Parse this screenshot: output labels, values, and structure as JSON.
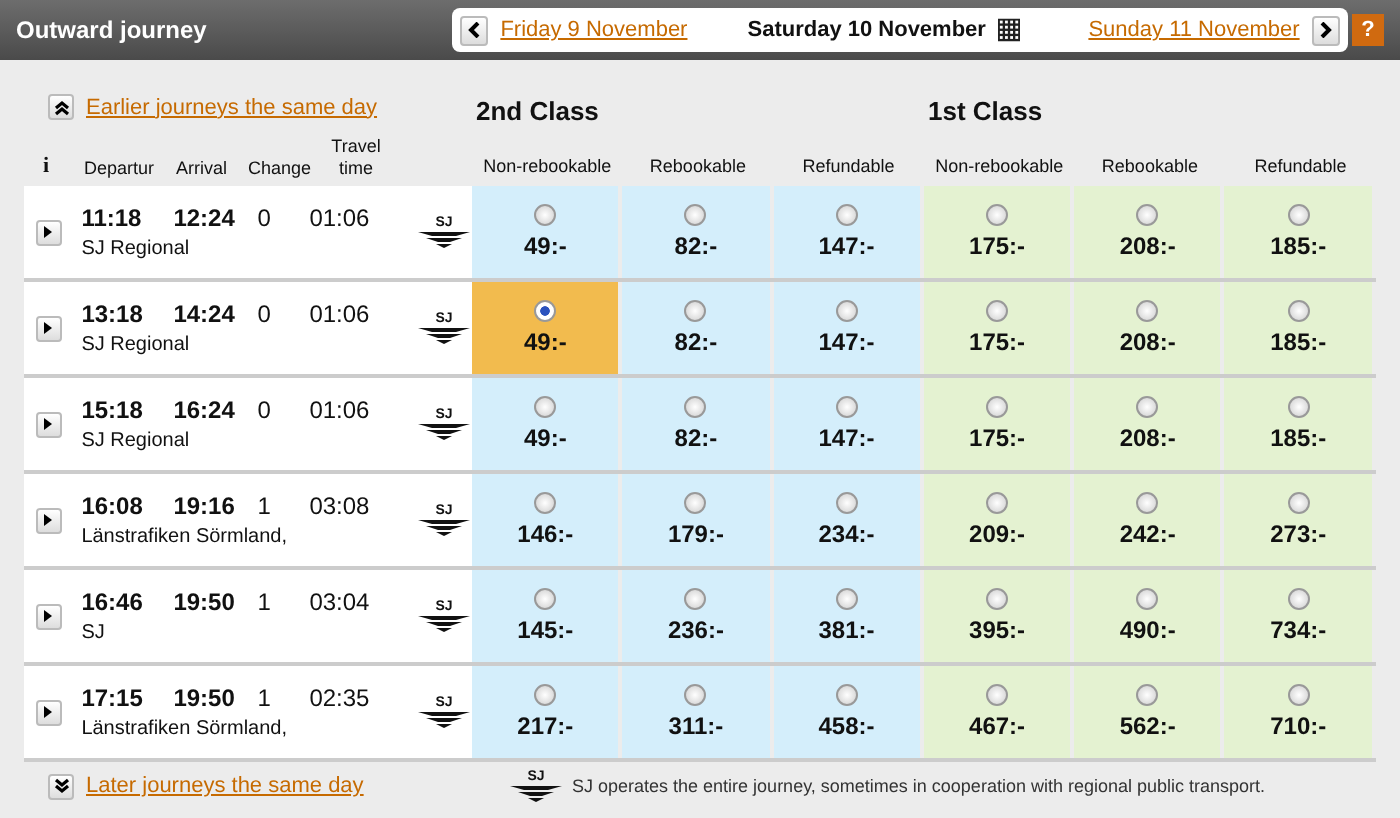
{
  "header": {
    "title": "Outward journey",
    "prev_date": "Friday 9 November",
    "current_date": "Saturday 10 November",
    "next_date": "Sunday 11 November",
    "help": "?"
  },
  "earlier_link": "Earlier journeys the same day",
  "classes": [
    {
      "name": "2nd Class",
      "fares": [
        "Non-rebookable",
        "Rebookable",
        "Refundable"
      ]
    },
    {
      "name": "1st Class",
      "fares": [
        "Non-rebookable",
        "Rebookable",
        "Refundable"
      ]
    }
  ],
  "columns": {
    "info": "i",
    "departure": "Departur",
    "arrival": "Arrival",
    "changes": "Change",
    "travel_time": "Travel time"
  },
  "journeys": [
    {
      "departure": "11:18",
      "arrival": "12:24",
      "changes": "0",
      "travel_time": "01:06",
      "operator": "SJ Regional",
      "logo": "SJ",
      "fares": [
        {
          "price": "49:-",
          "selected": false
        },
        {
          "price": "82:-",
          "selected": false
        },
        {
          "price": "147:-",
          "selected": false
        },
        {
          "price": "175:-",
          "selected": false
        },
        {
          "price": "208:-",
          "selected": false
        },
        {
          "price": "185:-",
          "selected": false
        }
      ]
    },
    {
      "departure": "13:18",
      "arrival": "14:24",
      "changes": "0",
      "travel_time": "01:06",
      "operator": "SJ Regional",
      "logo": "SJ",
      "fares": [
        {
          "price": "49:-",
          "selected": true
        },
        {
          "price": "82:-",
          "selected": false
        },
        {
          "price": "147:-",
          "selected": false
        },
        {
          "price": "175:-",
          "selected": false
        },
        {
          "price": "208:-",
          "selected": false
        },
        {
          "price": "185:-",
          "selected": false
        }
      ]
    },
    {
      "departure": "15:18",
      "arrival": "16:24",
      "changes": "0",
      "travel_time": "01:06",
      "operator": "SJ Regional",
      "logo": "SJ",
      "fares": [
        {
          "price": "49:-",
          "selected": false
        },
        {
          "price": "82:-",
          "selected": false
        },
        {
          "price": "147:-",
          "selected": false
        },
        {
          "price": "175:-",
          "selected": false
        },
        {
          "price": "208:-",
          "selected": false
        },
        {
          "price": "185:-",
          "selected": false
        }
      ]
    },
    {
      "departure": "16:08",
      "arrival": "19:16",
      "changes": "1",
      "travel_time": "03:08",
      "operator": "Länstrafiken Sörmland,",
      "logo": "SJ",
      "fares": [
        {
          "price": "146:-",
          "selected": false
        },
        {
          "price": "179:-",
          "selected": false
        },
        {
          "price": "234:-",
          "selected": false
        },
        {
          "price": "209:-",
          "selected": false
        },
        {
          "price": "242:-",
          "selected": false
        },
        {
          "price": "273:-",
          "selected": false
        }
      ]
    },
    {
      "departure": "16:46",
      "arrival": "19:50",
      "changes": "1",
      "travel_time": "03:04",
      "operator": "SJ",
      "logo": "SJ",
      "fares": [
        {
          "price": "145:-",
          "selected": false
        },
        {
          "price": "236:-",
          "selected": false
        },
        {
          "price": "381:-",
          "selected": false
        },
        {
          "price": "395:-",
          "selected": false
        },
        {
          "price": "490:-",
          "selected": false
        },
        {
          "price": "734:-",
          "selected": false
        }
      ]
    },
    {
      "departure": "17:15",
      "arrival": "19:50",
      "changes": "1",
      "travel_time": "02:35",
      "operator": "Länstrafiken Sörmland,",
      "logo": "SJ",
      "fares": [
        {
          "price": "217:-",
          "selected": false
        },
        {
          "price": "311:-",
          "selected": false
        },
        {
          "price": "458:-",
          "selected": false
        },
        {
          "price": "467:-",
          "selected": false
        },
        {
          "price": "562:-",
          "selected": false
        },
        {
          "price": "710:-",
          "selected": false
        }
      ]
    }
  ],
  "later_link": "Later journeys the same day",
  "footnote": {
    "logo": "SJ",
    "text": "SJ operates the entire journey, sometimes in cooperation with regional public transport."
  }
}
